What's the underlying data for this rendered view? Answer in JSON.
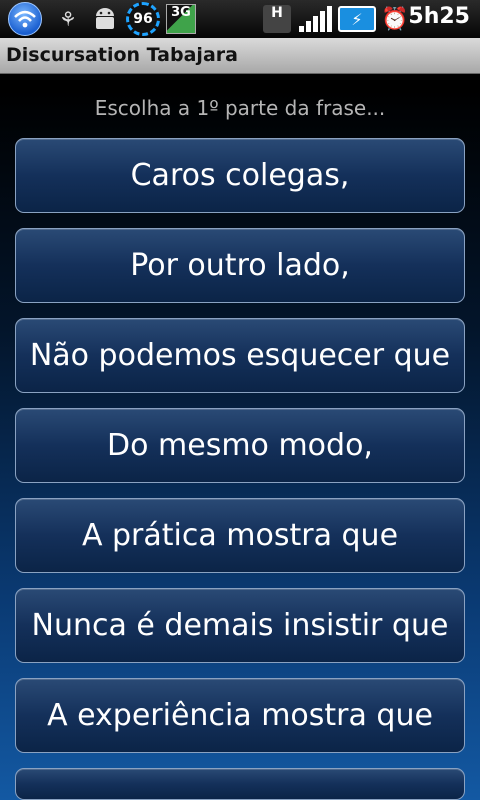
{
  "status_bar": {
    "battery_meter_value": "96",
    "network_type": "3G",
    "data_indicator": "H",
    "time": "5h25",
    "icons": [
      "wifi-icon",
      "usb-icon",
      "android-icon",
      "battery-meter-icon",
      "network-3g-icon",
      "h-data-icon",
      "signal-icon",
      "battery-icon",
      "alarm-icon"
    ]
  },
  "app": {
    "title": "Discursation Tabajara"
  },
  "main": {
    "prompt": "Escolha a 1º parte da frase...",
    "options": [
      {
        "label": "Caros colegas,"
      },
      {
        "label": "Por outro lado,"
      },
      {
        "label": "Não podemos esquecer que"
      },
      {
        "label": "Do mesmo modo,"
      },
      {
        "label": "A prática mostra que"
      },
      {
        "label": "Nunca é demais insistir que"
      },
      {
        "label": "A experiência mostra que"
      }
    ]
  }
}
